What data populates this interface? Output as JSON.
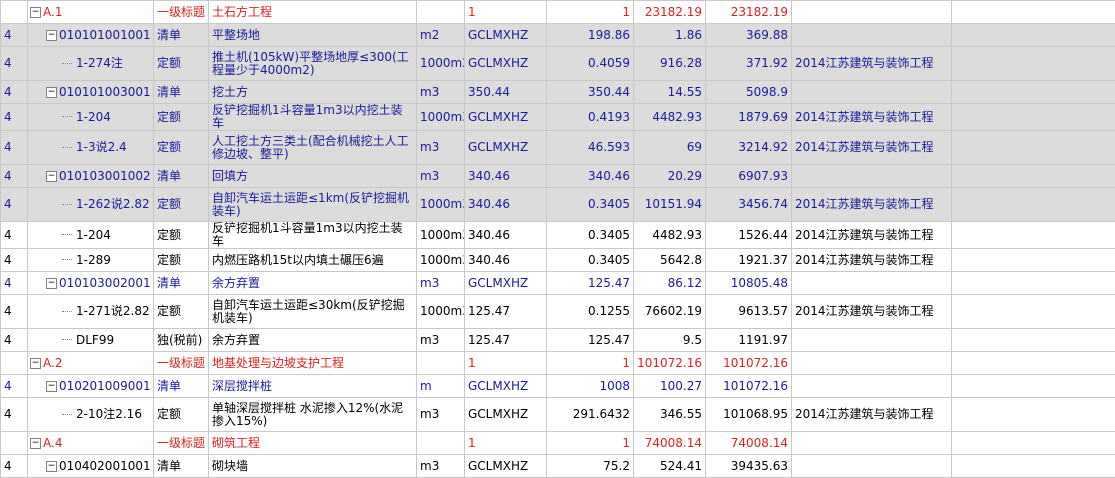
{
  "rows": [
    {
      "id": "r0",
      "type": "head",
      "c1": "",
      "code": "A.1",
      "kind": "一级标题",
      "name": "土石方工程",
      "unit": "",
      "qty": "1",
      "v1": "1",
      "price": "23182.19",
      "total": "23182.19",
      "note": "",
      "exp": true,
      "level": 0
    },
    {
      "id": "r1",
      "type": "sel",
      "c1": "4",
      "code": "010101001001",
      "kind": "清单",
      "name": "平整场地",
      "unit": "m2",
      "qty": "GCLMXHZ",
      "v1": "198.86",
      "price": "1.86",
      "total": "369.88",
      "note": "",
      "exp": true,
      "level": 1
    },
    {
      "id": "r2",
      "type": "sel",
      "c1": "4",
      "code": "1-274注",
      "kind": "定额",
      "name": "推土机(105kW)平整场地厚≤300(工程量少于4000m2)",
      "unit": "1000m2",
      "qty": "GCLMXHZ",
      "v1": "0.4059",
      "price": "916.28",
      "total": "371.92",
      "note": "2014江苏建筑与装饰工程",
      "exp": false,
      "level": 2,
      "tall": true
    },
    {
      "id": "r3",
      "type": "sel",
      "c1": "4",
      "code": "010101003001",
      "kind": "清单",
      "name": "挖土方",
      "unit": "m3",
      "qty": "350.44",
      "v1": "350.44",
      "price": "14.55",
      "total": "5098.9",
      "note": "",
      "exp": true,
      "level": 1
    },
    {
      "id": "r4",
      "type": "sel",
      "c1": "4",
      "code": "1-204",
      "kind": "定额",
      "name": "反铲挖掘机1斗容量1m3以内挖土装车",
      "unit": "1000m3",
      "qty": "GCLMXHZ",
      "v1": "0.4193",
      "price": "4482.93",
      "total": "1879.69",
      "note": "2014江苏建筑与装饰工程",
      "exp": false,
      "level": 2
    },
    {
      "id": "r5",
      "type": "sel",
      "c1": "4",
      "code": "1-3说2.4",
      "kind": "定额",
      "name": "人工挖土方三类土(配合机械挖土人工修边坡、整平)",
      "unit": "m3",
      "qty": "GCLMXHZ",
      "v1": "46.593",
      "price": "69",
      "total": "3214.92",
      "note": "2014江苏建筑与装饰工程",
      "exp": false,
      "level": 2,
      "tall": true
    },
    {
      "id": "r6",
      "type": "sel",
      "c1": "4",
      "code": "010103001002",
      "kind": "清单",
      "name": "回填方",
      "unit": "m3",
      "qty": "340.46",
      "v1": "340.46",
      "price": "20.29",
      "total": "6907.93",
      "note": "",
      "exp": true,
      "level": 1
    },
    {
      "id": "r7",
      "type": "sel",
      "c1": "4",
      "code": "1-262说2.82",
      "kind": "定额",
      "name": "自卸汽车运土运距≤1km(反铲挖掘机装车)",
      "unit": "1000m3",
      "qty": "340.46",
      "v1": "0.3405",
      "price": "10151.94",
      "total": "3456.74",
      "note": "2014江苏建筑与装饰工程",
      "exp": false,
      "level": 2,
      "tall": true
    },
    {
      "id": "r8",
      "type": "plain",
      "c1": "4",
      "code": "1-204",
      "kind": "定额",
      "name": "反铲挖掘机1斗容量1m3以内挖土装车",
      "unit": "1000m3",
      "qty": "340.46",
      "v1": "0.3405",
      "price": "4482.93",
      "total": "1526.44",
      "note": "2014江苏建筑与装饰工程",
      "exp": false,
      "level": 2
    },
    {
      "id": "r9",
      "type": "plain",
      "c1": "4",
      "code": "1-289",
      "kind": "定额",
      "name": "内燃压路机15t以内填土碾压6遍",
      "unit": "1000m3",
      "qty": "340.46",
      "v1": "0.3405",
      "price": "5642.8",
      "total": "1921.37",
      "note": "2014江苏建筑与装饰工程",
      "exp": false,
      "level": 2
    },
    {
      "id": "r10",
      "type": "blue",
      "c1": "4",
      "code": "010103002001",
      "kind": "清单",
      "name": "余方弃置",
      "unit": "m3",
      "qty": "GCLMXHZ",
      "v1": "125.47",
      "price": "86.12",
      "total": "10805.48",
      "note": "",
      "exp": true,
      "level": 1
    },
    {
      "id": "r11",
      "type": "plain",
      "c1": "4",
      "code": "1-271说2.82",
      "kind": "定额",
      "name": "自卸汽车运土运距≤30km(反铲挖掘机装车)",
      "unit": "1000m3",
      "qty": "125.47",
      "v1": "0.1255",
      "price": "76602.19",
      "total": "9613.57",
      "note": "2014江苏建筑与装饰工程",
      "exp": false,
      "level": 2,
      "tall": true
    },
    {
      "id": "r12",
      "type": "plain",
      "c1": "4",
      "code": "DLF99",
      "kind": "独(税前)",
      "name": "余方弃置",
      "unit": "m3",
      "qty": "125.47",
      "v1": "125.47",
      "price": "9.5",
      "total": "1191.97",
      "note": "",
      "exp": false,
      "level": 2
    },
    {
      "id": "r13",
      "type": "head",
      "c1": "",
      "code": "A.2",
      "kind": "一级标题",
      "name": "地基处理与边坡支护工程",
      "unit": "",
      "qty": "1",
      "v1": "1",
      "price": "101072.16",
      "total": "101072.16",
      "note": "",
      "exp": true,
      "level": 0
    },
    {
      "id": "r14",
      "type": "blue",
      "c1": "4",
      "code": "010201009001",
      "kind": "清单",
      "name": "深层搅拌桩",
      "unit": "m",
      "qty": "GCLMXHZ",
      "v1": "1008",
      "price": "100.27",
      "total": "101072.16",
      "note": "",
      "exp": true,
      "level": 1
    },
    {
      "id": "r15",
      "type": "plain",
      "c1": "4",
      "code": "2-10注2.16",
      "kind": "定额",
      "name": "单轴深层搅拌桩 水泥掺入12%(水泥掺入15%)",
      "unit": "m3",
      "qty": "GCLMXHZ",
      "v1": "291.6432",
      "price": "346.55",
      "total": "101068.95",
      "note": "2014江苏建筑与装饰工程",
      "exp": false,
      "level": 2,
      "tall": true
    },
    {
      "id": "r16",
      "type": "head",
      "c1": "",
      "code": "A.4",
      "kind": "一级标题",
      "name": "砌筑工程",
      "unit": "",
      "qty": "1",
      "v1": "1",
      "price": "74008.14",
      "total": "74008.14",
      "note": "",
      "exp": true,
      "level": 0
    },
    {
      "id": "r17",
      "type": "plain",
      "c1": "4",
      "code": "010402001001",
      "kind": "清单",
      "name": "砌块墙",
      "unit": "m3",
      "qty": "GCLMXHZ",
      "v1": "75.2",
      "price": "524.41",
      "total": "39435.63",
      "note": "",
      "exp": true,
      "level": 1
    }
  ]
}
